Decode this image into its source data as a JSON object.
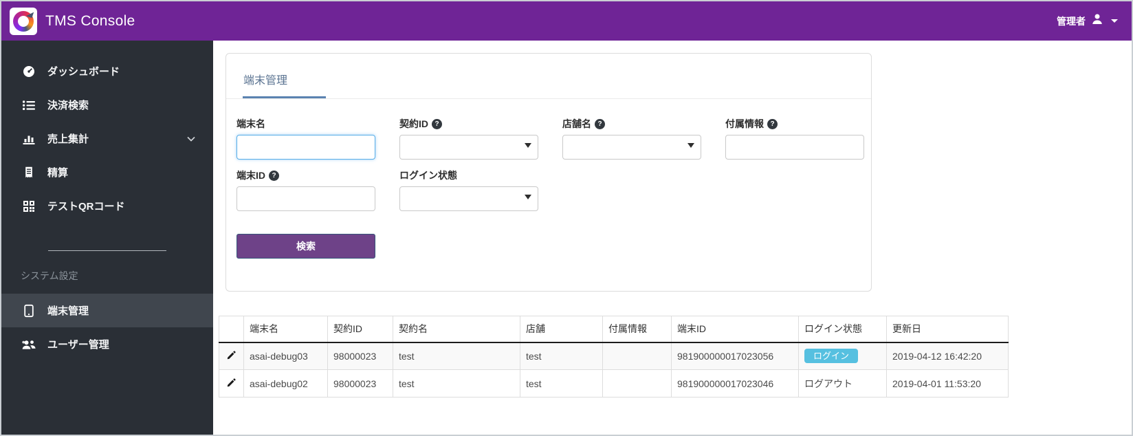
{
  "header": {
    "title": "TMS Console",
    "user_label": "管理者"
  },
  "sidebar": {
    "items": [
      {
        "label": "ダッシュボード"
      },
      {
        "label": "決済検索"
      },
      {
        "label": "売上集計"
      },
      {
        "label": "精算"
      },
      {
        "label": "テストQRコード"
      }
    ],
    "section_label": "システム設定",
    "system_items": [
      {
        "label": "端末管理"
      },
      {
        "label": "ユーザー管理"
      }
    ]
  },
  "card": {
    "tab_label": "端末管理",
    "form": {
      "terminal_name_label": "端末名",
      "terminal_name_value": "",
      "contract_id_label": "契約ID",
      "store_name_label": "店舗名",
      "extra_info_label": "付属情報",
      "extra_info_value": "",
      "terminal_id_label": "端末ID",
      "terminal_id_value": "",
      "login_state_label": "ログイン状態",
      "help_glyph": "?",
      "search_button_label": "検索"
    }
  },
  "table": {
    "headers": [
      "",
      "端末名",
      "契約ID",
      "契約名",
      "店舗",
      "付属情報",
      "端末ID",
      "ログイン状態",
      "更新日"
    ],
    "rows": [
      {
        "terminal_name": "asai-debug03",
        "contract_id": "98000023",
        "contract_name": "test",
        "store": "test",
        "extra_info": "",
        "terminal_id": "981900000017023056",
        "login_status": "ログイン",
        "updated_at": "2019-04-12 16:42:20"
      },
      {
        "terminal_name": "asai-debug02",
        "contract_id": "98000023",
        "contract_name": "test",
        "store": "test",
        "extra_info": "",
        "terminal_id": "981900000017023046",
        "login_status": "ログアウト",
        "updated_at": "2019-04-01 11:53:20"
      }
    ]
  },
  "colors": {
    "header_purple": "#6f2496",
    "sidebar_dark": "#2a2f36",
    "active_item": "#40464e",
    "button_purple": "#6e4288",
    "tab_underline": "#5b83b1",
    "focused_input": "#57ade8",
    "login_badge": "#56c0e0"
  }
}
